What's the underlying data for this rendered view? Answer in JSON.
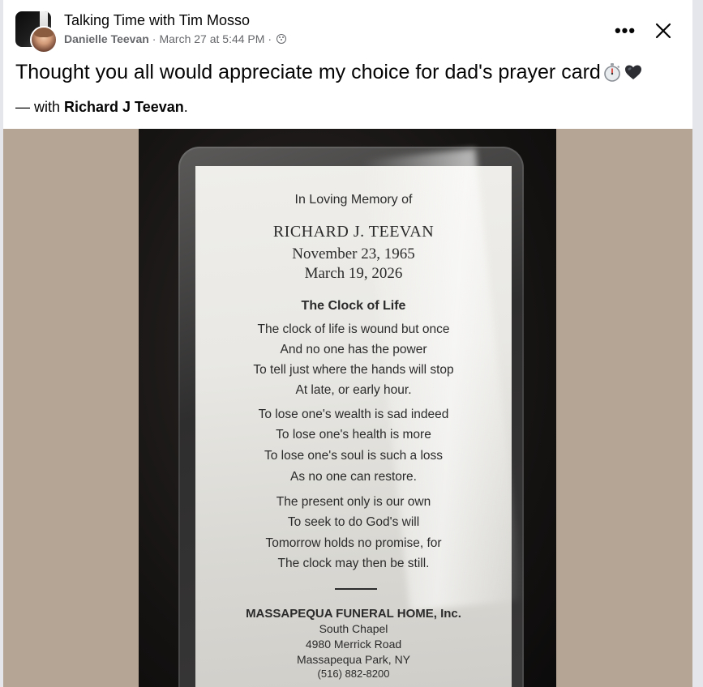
{
  "header": {
    "group_name": "Talking Time with Tim Mosso",
    "author": "Danielle Teevan",
    "separator": "·",
    "timestamp": "March 27 at 5:44 PM",
    "privacy_icon": "globe-icon"
  },
  "actions": {
    "more_icon": "•••",
    "close_icon": "close-icon"
  },
  "post": {
    "text": "Thought you all would appreciate my choice for dad's prayer card",
    "emojis": [
      "stopwatch-emoji",
      "black-heart-emoji"
    ],
    "with_prefix": "— with ",
    "tagged": "Richard J Teevan",
    "with_suffix": "."
  },
  "photo": {
    "card": {
      "heading": "In Loving Memory of",
      "name": "RICHARD J. TEEVAN",
      "born": "November 23, 1965",
      "died": "March 19, 2026",
      "poem_title": "The Clock of Life",
      "poem_lines": [
        "The clock of life is wound but once",
        "And no one has the power",
        "To tell just where the hands will stop",
        "At late, or early hour.",
        "To lose one's wealth is sad indeed",
        "To lose one's health is more",
        "To lose one's soul is such a loss",
        "As no one can restore.",
        "The present only is our own",
        "To seek to do God's will",
        "Tomorrow holds no promise, for",
        "The clock may then be still."
      ],
      "funeral_home": "MASSAPEQUA FUNERAL HOME, Inc.",
      "chapel": "South Chapel",
      "address": "4980 Merrick Road",
      "city": "Massapequa Park, NY",
      "phone": "(516) 882-8200"
    }
  }
}
